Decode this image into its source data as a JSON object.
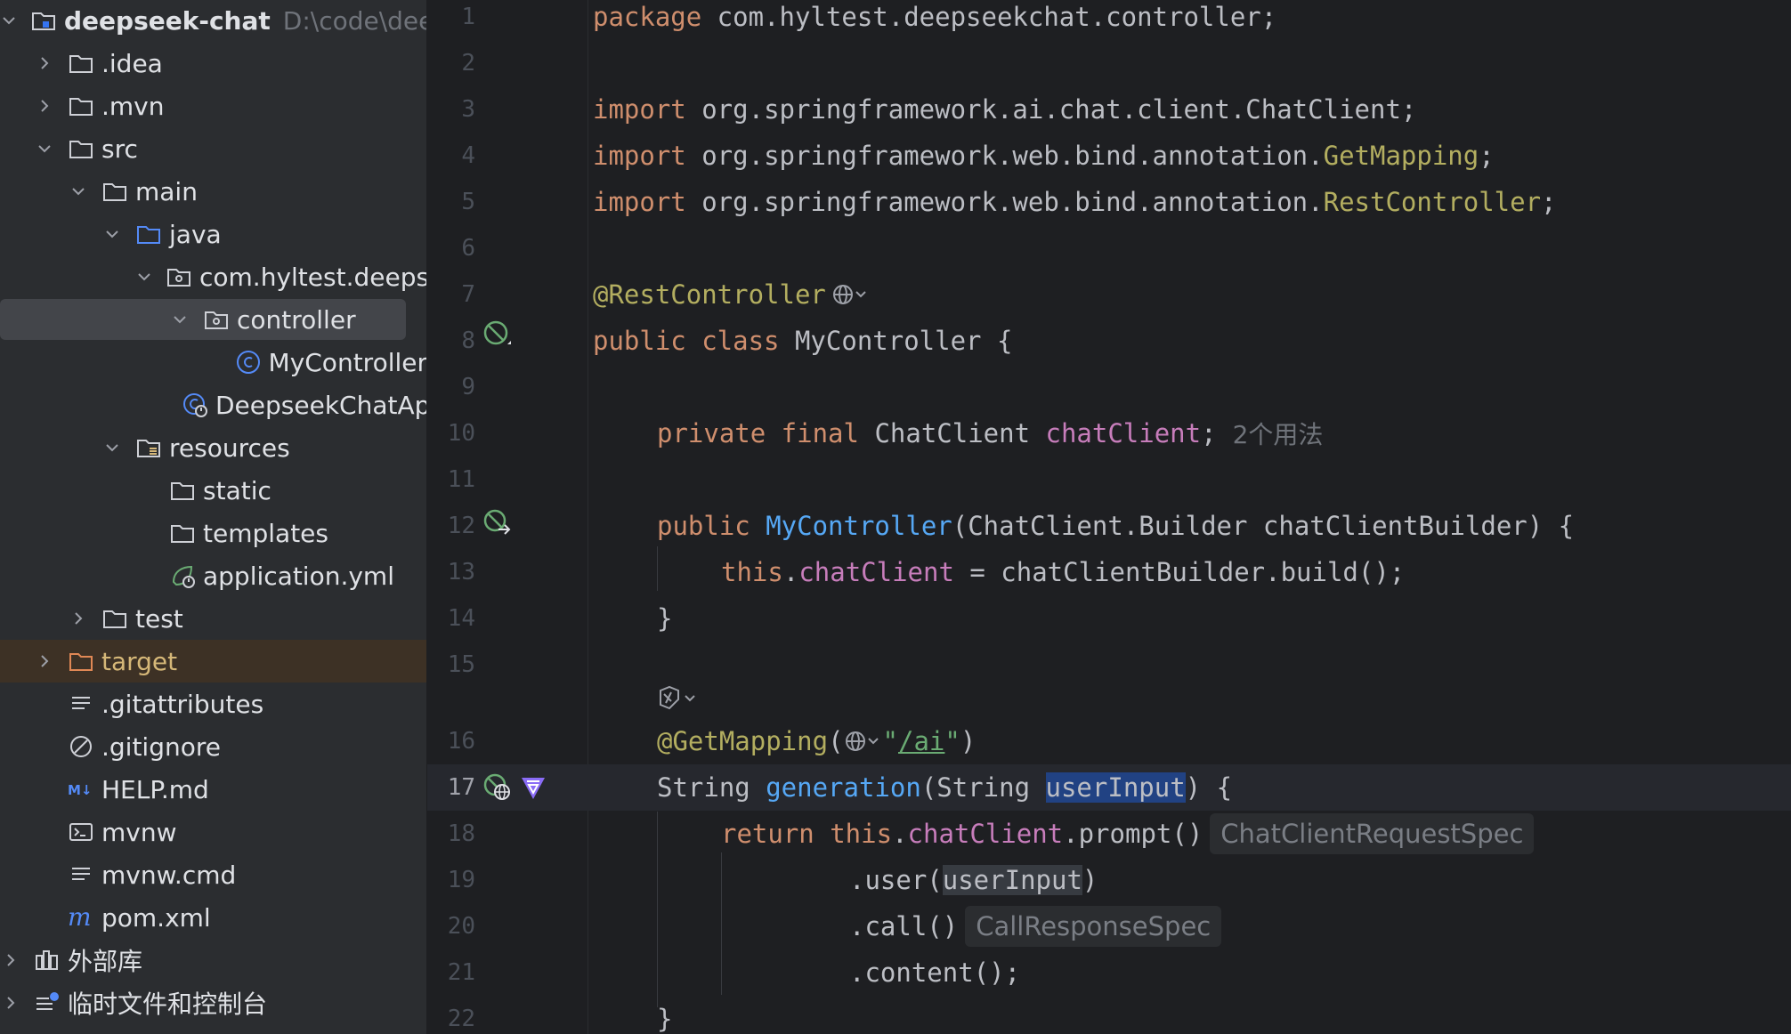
{
  "project_tree": {
    "root": {
      "label": "deepseek-chat",
      "path": "D:\\code\\deepse"
    },
    "items": [
      {
        "label": ".idea"
      },
      {
        "label": ".mvn"
      },
      {
        "label": "src"
      },
      {
        "label": "main"
      },
      {
        "label": "java"
      },
      {
        "label": "com.hyltest.deepsee"
      },
      {
        "label": "controller"
      },
      {
        "label": "MyController"
      },
      {
        "label": "DeepseekChatAp"
      },
      {
        "label": "resources"
      },
      {
        "label": "static"
      },
      {
        "label": "templates"
      },
      {
        "label": "application.yml"
      },
      {
        "label": "test"
      },
      {
        "label": "target"
      },
      {
        "label": ".gitattributes"
      },
      {
        "label": ".gitignore"
      },
      {
        "label": "HELP.md"
      },
      {
        "label": "mvnw"
      },
      {
        "label": "mvnw.cmd"
      },
      {
        "label": "pom.xml"
      },
      {
        "label": "外部库"
      },
      {
        "label": "临时文件和控制台"
      }
    ]
  },
  "editor": {
    "line_numbers": [
      "1",
      "2",
      "3",
      "4",
      "5",
      "6",
      "7",
      "8",
      "9",
      "10",
      "11",
      "12",
      "13",
      "14",
      "15",
      "16",
      "17",
      "18",
      "19",
      "20",
      "21",
      "22"
    ],
    "current_line": "17",
    "tokens": {
      "l1a": "package",
      "l1b": " com.hyltest.deepseekchat.controller;",
      "l3a": "import",
      "l3b": " org.springframework.ai.chat.client.ChatClient;",
      "l4a": "import",
      "l4b": " org.springframework.web.bind.annotation.",
      "l4c": "GetMapping",
      "l4d": ";",
      "l5a": "import",
      "l5b": " org.springframework.web.bind.annotation.",
      "l5c": "RestController",
      "l5d": ";",
      "l7a": "@RestController",
      "l8a": "public class",
      "l8b": " MyController {",
      "l10a": "private final",
      "l10b": " ChatClient ",
      "l10c": "chatClient",
      "l10d": ";",
      "l10hint": "2个用法",
      "l12a": "public ",
      "l12b": "MyController",
      "l12c": "(ChatClient.Builder chatClientBuilder) {",
      "l13a": "this",
      "l13b": ".",
      "l13c": "chatClient",
      "l13d": " = chatClientBuilder.build();",
      "l14a": "}",
      "l16a": "@GetMapping",
      "l16b": "(",
      "l16c": "\"",
      "l16d": "/ai",
      "l16e": "\"",
      "l16f": ")",
      "l17a": "String ",
      "l17b": "generation",
      "l17c": "(String ",
      "l17d": "userInput",
      "l17e": ") {",
      "l18a": "return ",
      "l18b": "this",
      "l18c": ".",
      "l18d": "chatClient",
      "l18e": ".prompt()",
      "l18hint": "ChatClientRequestSpec",
      "l19a": ".user(",
      "l19b": "userInput",
      "l19c": ")",
      "l20a": ".call()",
      "l20hint": "CallResponseSpec",
      "l21a": ".content();",
      "l22a": "}"
    }
  },
  "colors": {
    "keyword": "#cf8e6d",
    "annotation": "#b3ae60",
    "field": "#c77dbb",
    "function": "#56a8f5",
    "string": "#6aab73",
    "text": "#bcbec4",
    "selection": "#214283"
  }
}
